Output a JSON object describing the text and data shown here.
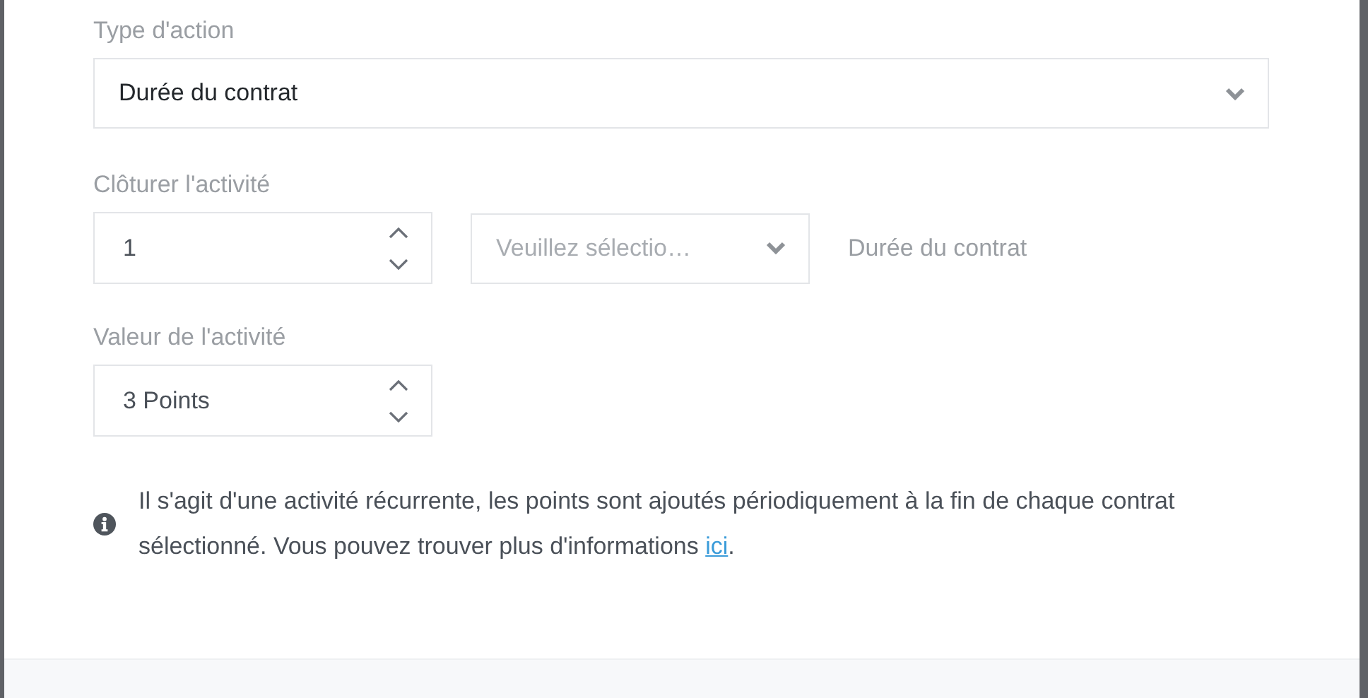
{
  "action_type": {
    "label": "Type d'action",
    "value": "Durée du contrat"
  },
  "close_activity": {
    "label": "Clôturer l'activité",
    "number": "1",
    "unit_select": {
      "placeholder": "Veuillez sélectio…"
    },
    "suffix": "Durée du contrat"
  },
  "activity_value": {
    "label": "Valeur de l'activité",
    "value": "3 Points"
  },
  "info": {
    "text": "Il s'agit d'une activité récurrente, les points sont ajoutés périodiquement à la fin de chaque contrat sélectionné. Vous pouvez trouver plus d'informations ",
    "link": "ici",
    "text_after": "."
  }
}
